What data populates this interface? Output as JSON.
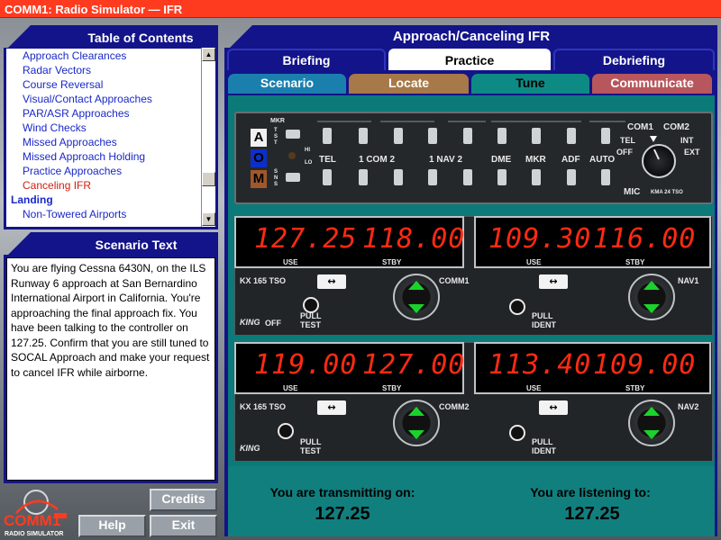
{
  "window": {
    "title": "COMM1:  Radio Simulator — IFR"
  },
  "toc": {
    "title": "Table of Contents",
    "items": [
      {
        "label": "Approach Clearances",
        "kind": "item"
      },
      {
        "label": "Radar Vectors",
        "kind": "item"
      },
      {
        "label": "Course Reversal",
        "kind": "item"
      },
      {
        "label": "Visual/Contact Approaches",
        "kind": "item"
      },
      {
        "label": "PAR/ASR Approaches",
        "kind": "item"
      },
      {
        "label": "Wind Checks",
        "kind": "item"
      },
      {
        "label": "Missed Approaches",
        "kind": "item"
      },
      {
        "label": "Missed Approach Holding",
        "kind": "item"
      },
      {
        "label": "Practice Approaches",
        "kind": "item"
      },
      {
        "label": "Canceling IFR",
        "kind": "current"
      },
      {
        "label": "Landing",
        "kind": "section"
      },
      {
        "label": "Non-Towered Airports",
        "kind": "item"
      }
    ]
  },
  "scenario": {
    "title": "Scenario Text",
    "text": "You are flying Cessna 6430N, on the ILS Runway 6 approach at San Bernardino International Airport in California. You're approaching the final approach fix. You have been talking to the controller on 127.25. Confirm that you are still tuned to SOCAL Approach and make your request to cancel IFR while airborne."
  },
  "logo": {
    "brand": "COMM1",
    "tagline": "RADIO SIMULATOR"
  },
  "buttons": {
    "credits": "Credits",
    "help": "Help",
    "exit": "Exit"
  },
  "lesson": {
    "title": "Approach/Canceling IFR"
  },
  "tabs": {
    "briefing": "Briefing",
    "practice": "Practice",
    "debriefing": "Debriefing"
  },
  "subtabs": {
    "scenario": "Scenario",
    "locate": "Locate",
    "tune": "Tune",
    "communicate": "Communicate"
  },
  "colors": {
    "scenario": "#1b7fae",
    "locate": "#a77848",
    "tune": "#0e8a84",
    "communicate": "#b8565e"
  },
  "audio_panel": {
    "mkr": "MKR",
    "tst": "TST",
    "sns": "SNS",
    "hi": "HI",
    "lo": "LO",
    "marker_a": "A",
    "marker_o": "O",
    "marker_m": "M",
    "labels": [
      "TEL",
      "1 COM 2",
      "1 NAV 2",
      "DME",
      "MKR",
      "ADF",
      "AUTO"
    ],
    "com1": "COM1",
    "com2": "COM2",
    "tel": "TEL",
    "off": "OFF",
    "int": "INT",
    "ext": "EXT",
    "mic": "MIC",
    "model": "KMA 24 TSO"
  },
  "radios": {
    "com1": {
      "use": "127.25",
      "stby": "118.00",
      "label": "COMM1",
      "model": "KX 165 TSO"
    },
    "nav1": {
      "use": "109.30",
      "stby": "116.00",
      "label": "NAV1"
    },
    "com2": {
      "use": "119.00",
      "stby": "127.00",
      "label": "COMM2",
      "model": "KX 165 TSO"
    },
    "nav2": {
      "use": "113.40",
      "stby": "109.00",
      "label": "NAV2"
    },
    "use_label": "USE",
    "stby_label": "STBY",
    "swap": "↔",
    "pull_test": "PULL\nTEST",
    "pull_ident": "PULL\nIDENT",
    "king": "KING",
    "off": "OFF"
  },
  "status": {
    "transmitting_label": "You are transmitting on:",
    "transmitting_value": "127.25",
    "listening_label": "You are listening to:",
    "listening_value": "127.25"
  }
}
